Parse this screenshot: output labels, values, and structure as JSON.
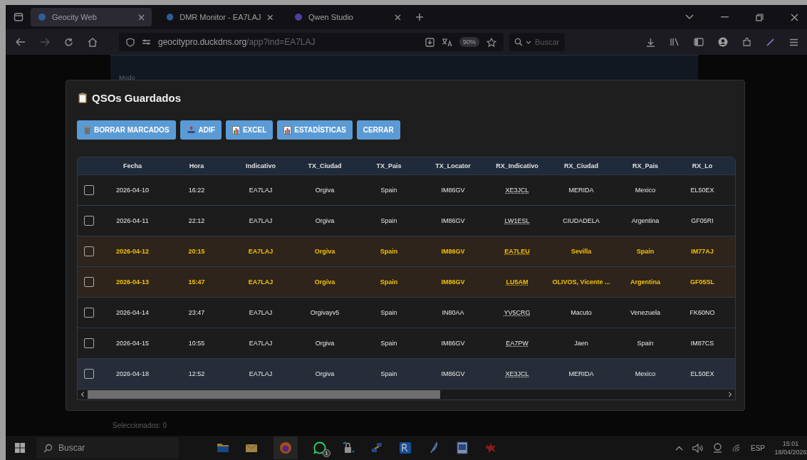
{
  "browser": {
    "tabs": [
      {
        "label": "Geocity Web",
        "selected": true
      },
      {
        "label": "DMR Monitor - EA7LAJ",
        "selected": false
      },
      {
        "label": "Qwen Studio",
        "selected": false
      }
    ],
    "url_host": "geocitypro.duckdns.org",
    "url_path": "/app?ind=EA7LAJ",
    "zoom": "90%",
    "search": {
      "placeholder": "Buscar"
    }
  },
  "page": {
    "field_label": "Modo",
    "selected_count": "Seleccionados: 0"
  },
  "dialog": {
    "title": "QSOs Guardados",
    "buttons": [
      {
        "label": "BORRAR MARCADOS",
        "kind": "trash"
      },
      {
        "label": "ADIF",
        "kind": "upload"
      },
      {
        "label": "EXCEL",
        "kind": "chart"
      },
      {
        "label": "ESTADÍSTICAS",
        "kind": "chart"
      },
      {
        "label": "CERRAR",
        "kind": "plain"
      }
    ],
    "table": {
      "columns": [
        "Fecha",
        "Hora",
        "Indicativo",
        "TX_Ciudad",
        "TX_Pais",
        "TX_Locator",
        "RX_Indicativo",
        "RX_Ciudad",
        "RX_Pais",
        "RX_Lo"
      ],
      "rows": [
        {
          "checked": false,
          "highlighted": false,
          "hovered": false,
          "cells": [
            "2026-04-10",
            "16:22",
            "EA7LAJ",
            "Orgiva",
            "Spain",
            "IM86GV",
            "XE3JCL",
            "MERIDA",
            "Mexico",
            "EL50EX"
          ]
        },
        {
          "checked": false,
          "highlighted": false,
          "hovered": false,
          "cells": [
            "2026-04-11",
            "22:12",
            "EA7LAJ",
            "Orgiva",
            "Spain",
            "IM86GV",
            "LW1ESL",
            "CIUDADELA",
            "Argentina",
            "GF05RI"
          ]
        },
        {
          "checked": false,
          "highlighted": true,
          "hovered": false,
          "cells": [
            "2026-04-12",
            "20:15",
            "EA7LAJ",
            "Orgiva",
            "Spain",
            "IM86GV",
            "EA7LEU",
            "Sevilla",
            "Spain",
            "IM77AJ"
          ]
        },
        {
          "checked": false,
          "highlighted": true,
          "hovered": false,
          "cells": [
            "2026-04-13",
            "15:47",
            "EA7LAJ",
            "Orgiva",
            "Spain",
            "IM86GV",
            "LU5AM",
            "OLIVOS, Vicente ...",
            "Argentina",
            "GF05SL"
          ]
        },
        {
          "checked": false,
          "highlighted": false,
          "hovered": false,
          "cells": [
            "2026-04-14",
            "23:47",
            "EA7LAJ",
            "Orgivayv5",
            "Spain",
            "IN80AA",
            "YV5CRG",
            "Macuto",
            "Venezuela",
            "FK60NO"
          ]
        },
        {
          "checked": false,
          "highlighted": false,
          "hovered": false,
          "cells": [
            "2026-04-15",
            "10:55",
            "EA7LAJ",
            "Orgiva",
            "Spain",
            "IM86GV",
            "EA7PW",
            "Jaen",
            "Spain",
            "IM87CS"
          ]
        },
        {
          "checked": false,
          "highlighted": false,
          "hovered": true,
          "cells": [
            "2026-04-18",
            "12:52",
            "EA7LAJ",
            "Orgiva",
            "Spain",
            "IM86GV",
            "XE3JCL",
            "MERIDA",
            "Mexico",
            "EL50EX"
          ]
        }
      ]
    }
  },
  "taskbar": {
    "search": {
      "placeholder": "Buscar"
    },
    "whatsapp_badge": "1",
    "language": "ESP",
    "time": "15:01",
    "date": "18/04/2026"
  }
}
